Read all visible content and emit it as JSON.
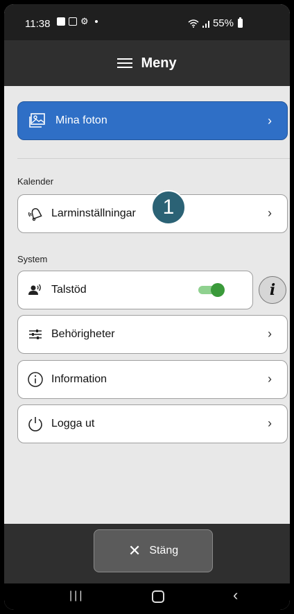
{
  "status_bar": {
    "time": "11:38",
    "battery": "55%"
  },
  "header": {
    "title": "Meny"
  },
  "photos_button": {
    "label": "Mina foton",
    "chevron": "›"
  },
  "sections": {
    "calendar_label": "Kalender",
    "system_label": "System"
  },
  "items": {
    "alarm_settings": "Larminställningar",
    "speech_support": "Talstöd",
    "permissions": "Behörigheter",
    "information": "Information",
    "logout": "Logga ut",
    "chevron": "›"
  },
  "speech_support_toggle": {
    "on": true
  },
  "info_button": {
    "glyph": "i"
  },
  "badge": {
    "number": "1"
  },
  "footer": {
    "close_label": "Stäng",
    "close_glyph": "✕"
  },
  "nav": {
    "recent": "|||",
    "back": "‹"
  },
  "colors": {
    "accent_blue": "#2f6fc6",
    "toggle_green": "#3a9a3a",
    "badge": "#2b6275",
    "header_bg": "#2f2f2f"
  },
  "icons": {
    "photos": "photo-icon",
    "alarm": "alarm-bell-icon",
    "speech": "speaking-person-icon",
    "permissions": "sliders-icon",
    "information": "info-circle-icon",
    "logout": "power-icon"
  }
}
